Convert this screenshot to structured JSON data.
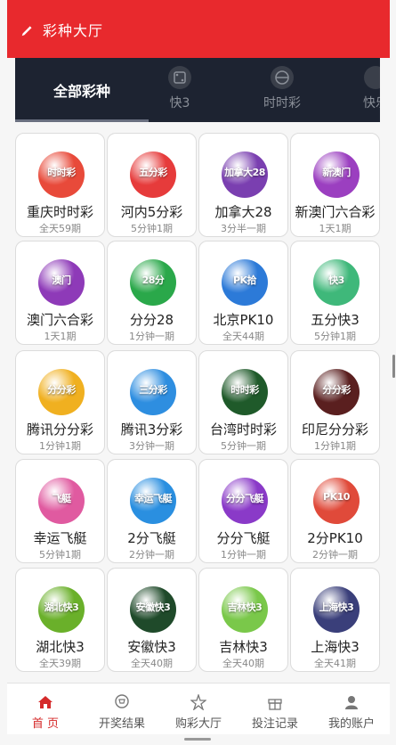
{
  "header": {
    "title": "彩种大厅",
    "color": "#e8292d"
  },
  "tabs": {
    "all_label": "全部彩种",
    "items": [
      {
        "label": "快3",
        "icon": "dice-icon"
      },
      {
        "label": "时时彩",
        "icon": "ball-icon"
      },
      {
        "label": "快乐",
        "icon": "lottery-icon"
      }
    ]
  },
  "games": [
    {
      "name": "重庆时时彩",
      "period": "全天59期",
      "logo": "时时彩",
      "color": "#e84a3a"
    },
    {
      "name": "河内5分彩",
      "period": "5分钟1期",
      "logo": "五分彩",
      "color": "#e63b3b"
    },
    {
      "name": "加拿大28",
      "period": "3分半一期",
      "logo": "加拿大28",
      "color": "#7a3fb0"
    },
    {
      "name": "新澳门六合彩",
      "period": "1天1期",
      "logo": "新澳门",
      "color": "#9b3fc0"
    },
    {
      "name": "澳门六合彩",
      "period": "1天1期",
      "logo": "澳门",
      "color": "#8e3ab8"
    },
    {
      "name": "分分28",
      "period": "1分钟一期",
      "logo": "28分",
      "color": "#2aa84a"
    },
    {
      "name": "北京PK10",
      "period": "全天44期",
      "logo": "PK拾",
      "color": "#2c7ad8"
    },
    {
      "name": "五分快3",
      "period": "5分钟1期",
      "logo": "快3",
      "color": "#3fb87a"
    },
    {
      "name": "腾讯分分彩",
      "period": "1分钟1期",
      "logo": "分分彩",
      "color": "#f0b020"
    },
    {
      "name": "腾讯3分彩",
      "period": "3分钟一期",
      "logo": "三分彩",
      "color": "#2e8ee0"
    },
    {
      "name": "台湾时时彩",
      "period": "5分钟一期",
      "logo": "时时彩",
      "color": "#1f5a2a"
    },
    {
      "name": "印尼分分彩",
      "period": "1分钟1期",
      "logo": "分分彩",
      "color": "#5a1f1f"
    },
    {
      "name": "幸运飞艇",
      "period": "5分钟1期",
      "logo": "飞艇",
      "color": "#e05aa0"
    },
    {
      "name": "2分飞艇",
      "period": "2分钟一期",
      "logo": "幸运飞艇",
      "color": "#2a8fe0"
    },
    {
      "name": "分分飞艇",
      "period": "1分钟一期",
      "logo": "分分飞艇",
      "color": "#8a3ac8"
    },
    {
      "name": "2分PK10",
      "period": "2分钟一期",
      "logo": "PK10",
      "color": "#e04a3a"
    },
    {
      "name": "湖北快3",
      "period": "全天39期",
      "logo": "湖北快3",
      "color": "#6ab02a"
    },
    {
      "name": "安徽快3",
      "period": "全天40期",
      "logo": "安徽快3",
      "color": "#1f4a2a"
    },
    {
      "name": "吉林快3",
      "period": "全天40期",
      "logo": "吉林快3",
      "color": "#7ac84a"
    },
    {
      "name": "上海快3",
      "period": "全天41期",
      "logo": "上海快3",
      "color": "#3a3f7a"
    }
  ],
  "bottom_nav": [
    {
      "label": "首 页",
      "icon": "home-icon",
      "active": true
    },
    {
      "label": "开奖结果",
      "icon": "trophy-icon",
      "active": false
    },
    {
      "label": "购彩大厅",
      "icon": "star-icon",
      "active": false
    },
    {
      "label": "投注记录",
      "icon": "gift-icon",
      "active": false
    },
    {
      "label": "我的账户",
      "icon": "user-icon",
      "active": false
    }
  ]
}
